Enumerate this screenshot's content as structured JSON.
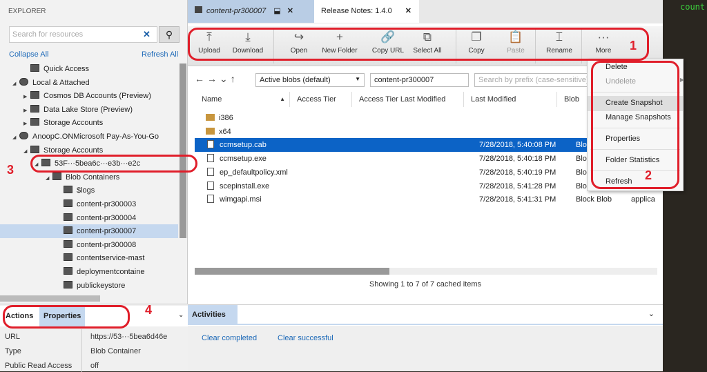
{
  "explorer": {
    "title": "EXPLORER",
    "search_placeholder": "Search for resources",
    "collapse_all": "Collapse All",
    "refresh_all": "Refresh All",
    "tree": [
      {
        "label": "Quick Access",
        "level": 1,
        "twisty": ""
      },
      {
        "label": "Local & Attached",
        "level": 0,
        "twisty": "◢"
      },
      {
        "label": "Cosmos DB Accounts (Preview)",
        "level": 1,
        "twisty": "▶"
      },
      {
        "label": "Data Lake Store (Preview)",
        "level": 1,
        "twisty": "▶"
      },
      {
        "label": "Storage Accounts",
        "level": 1,
        "twisty": "▶"
      },
      {
        "label": "AnoopC.ONMicrosoft Pay-As-You-Go",
        "level": 0,
        "twisty": "◢"
      },
      {
        "label": "Storage Accounts",
        "level": 1,
        "twisty": "◢"
      },
      {
        "label": "53F···5bea6c···e3b···e2c",
        "level": 2,
        "twisty": "◢"
      },
      {
        "label": "Blob Containers",
        "level": 3,
        "twisty": "◢"
      },
      {
        "label": "$logs",
        "level": 4,
        "twisty": ""
      },
      {
        "label": "content-pr300003",
        "level": 4,
        "twisty": ""
      },
      {
        "label": "content-pr300004",
        "level": 4,
        "twisty": ""
      },
      {
        "label": "content-pr300007",
        "level": 4,
        "twisty": "",
        "selected": true
      },
      {
        "label": "content-pr300008",
        "level": 4,
        "twisty": ""
      },
      {
        "label": "contentservice-mast",
        "level": 4,
        "twisty": ""
      },
      {
        "label": "deploymentcontaine",
        "level": 4,
        "twisty": ""
      },
      {
        "label": "publickeystore",
        "level": 4,
        "twisty": ""
      }
    ]
  },
  "bottom_left": {
    "tabs": [
      "Actions",
      "Properties"
    ],
    "properties": [
      [
        "URL",
        "https://53···5bea6d46e"
      ],
      [
        "Type",
        "Blob Container"
      ],
      [
        "Public Read Access",
        "off"
      ]
    ]
  },
  "tabs": [
    {
      "label": "content-pr300007",
      "active": true
    },
    {
      "label": "Release Notes: 1.4.0"
    }
  ],
  "toolbar": [
    {
      "label": "Upload",
      "icon": "⤒"
    },
    {
      "label": "Download",
      "icon": "⤓"
    },
    {
      "label": "Open",
      "icon": "↪"
    },
    {
      "label": "New Folder",
      "icon": "+"
    },
    {
      "label": "Copy URL",
      "icon": "🔗"
    },
    {
      "label": "Select All",
      "icon": "⧉"
    },
    {
      "label": "Copy",
      "icon": "❐"
    },
    {
      "label": "Paste",
      "icon": "📋",
      "disabled": true
    },
    {
      "label": "Rename",
      "icon": "⌶"
    },
    {
      "label": "More",
      "icon": "···"
    }
  ],
  "address": {
    "view": "Active blobs (default)",
    "path": "content-pr300007",
    "search_placeholder": "Search by prefix (case-sensitive)"
  },
  "columns": [
    "Name",
    "Access Tier",
    "Access Tier Last Modified",
    "Last Modified",
    "Blob"
  ],
  "rows": [
    {
      "name": "i386",
      "type": "folder",
      "modified": "",
      "blob": "",
      "extra": ""
    },
    {
      "name": "x64",
      "type": "folder",
      "modified": "",
      "blob": "",
      "extra": ""
    },
    {
      "name": "ccmsetup.cab",
      "type": "file",
      "modified": "7/28/2018, 5:40:08 PM",
      "blob": "Bloc",
      "extra": "",
      "selected": true
    },
    {
      "name": "ccmsetup.exe",
      "type": "file",
      "modified": "7/28/2018, 5:40:18 PM",
      "blob": "Bloc",
      "extra": ""
    },
    {
      "name": "ep_defaultpolicy.xml",
      "type": "file",
      "modified": "7/28/2018, 5:40:19 PM",
      "blob": "Bloc",
      "extra": ""
    },
    {
      "name": "scepinstall.exe",
      "type": "file",
      "modified": "7/28/2018, 5:41:28 PM",
      "blob": "Bloc",
      "extra": ""
    },
    {
      "name": "wimgapi.msi",
      "type": "file",
      "modified": "7/28/2018, 5:41:31 PM",
      "blob": "Block Blob",
      "extra": "applica"
    }
  ],
  "status": "Showing 1 to 7 of 7 cached items",
  "activities": {
    "title": "Activities",
    "clear_completed": "Clear completed",
    "clear_successful": "Clear successful"
  },
  "context_menu": [
    {
      "label": "Delete"
    },
    {
      "label": "Undelete",
      "disabled": true
    },
    {
      "label": "Create Snapshot",
      "hover": true
    },
    {
      "label": "Manage Snapshots"
    },
    {
      "label": "Properties"
    },
    {
      "label": "Folder Statistics"
    },
    {
      "label": "Refresh"
    }
  ],
  "annotations": [
    "1",
    "2",
    "3",
    "4"
  ],
  "background_text": "count",
  "colors": {
    "selection": "#0c63c6",
    "annotation": "#e01e2a",
    "link": "#1e6ab8"
  }
}
